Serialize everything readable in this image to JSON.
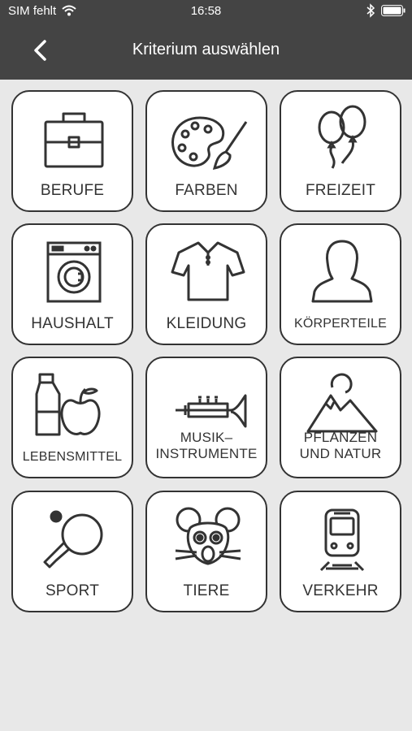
{
  "status": {
    "carrier": "SIM fehlt",
    "time": "16:58"
  },
  "header": {
    "title": "Kriterium auswählen"
  },
  "tiles": [
    {
      "label": "BERUFE",
      "icon": "briefcase-icon"
    },
    {
      "label": "FARBEN",
      "icon": "palette-icon"
    },
    {
      "label": "FREIZEIT",
      "icon": "balloons-icon"
    },
    {
      "label": "HAUSHALT",
      "icon": "washing-machine-icon"
    },
    {
      "label": "KLEIDUNG",
      "icon": "shirt-icon"
    },
    {
      "label": "KÖRPERTEILE",
      "icon": "person-icon"
    },
    {
      "label": "LEBENSMITTEL",
      "icon": "milk-apple-icon"
    },
    {
      "label_line1": "MUSIK–",
      "label_line2": "INSTRUMENTE",
      "icon": "trumpet-icon"
    },
    {
      "label_line1": "PFLANZEN",
      "label_line2": "UND NATUR",
      "icon": "mountain-icon"
    },
    {
      "label": "SPORT",
      "icon": "ping-pong-icon"
    },
    {
      "label": "TIERE",
      "icon": "mouse-icon"
    },
    {
      "label": "VERKEHR",
      "icon": "train-icon"
    }
  ]
}
